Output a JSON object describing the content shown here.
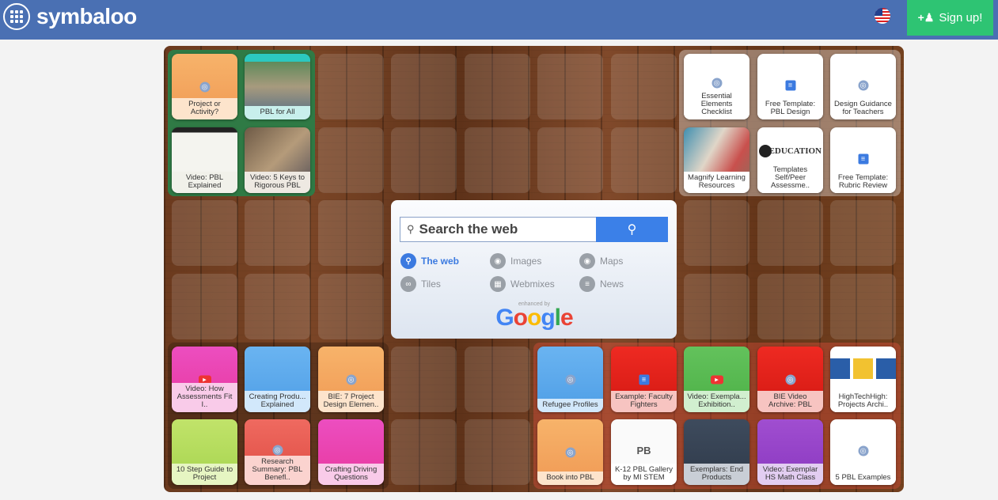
{
  "header": {
    "brand": "symbaloo",
    "signup_label": "Sign up!"
  },
  "colors": {
    "header_bg": "#4a70b3",
    "signup_bg": "#2ec473",
    "search_accent": "#3b80e8"
  },
  "search": {
    "placeholder": "Search the web",
    "options": [
      {
        "label": "The web",
        "icon": "search-icon"
      },
      {
        "label": "Images",
        "icon": "camera-icon"
      },
      {
        "label": "Maps",
        "icon": "map-pin-icon"
      },
      {
        "label": "Tiles",
        "icon": "link-icon"
      },
      {
        "label": "Webmixes",
        "icon": "grid-icon"
      },
      {
        "label": "News",
        "icon": "menu-icon"
      }
    ],
    "enhanced_by": "enhanced by",
    "provider": "Google"
  },
  "tiles": {
    "project_or_activity": "Project or Activity?",
    "pbl_for_all": "PBL for All",
    "video_pbl_explained": "Video: PBL Explained",
    "video_5_keys": "Video: 5 Keys to Rigorous PBL",
    "essential_elements": "Essential Elements Checklist",
    "free_template_pbl": "Free Template: PBL Design",
    "design_guidance": "Design Guidance for Teachers",
    "magnify_learning": "Magnify Learning Resources",
    "education_logo": "EDUCATION",
    "templates_self_peer": "Templates Self/Peer Assessme..",
    "free_template_rubric": "Free Template: Rubric Review",
    "video_how_assessments": "Video: How Assessments Fit I..",
    "creating_products": "Creating Produ... Explained",
    "bie_7_project": "BIE: 7 Project Design Elemen..",
    "refugee_profiles": "Refugee Profiles",
    "example_faculty": "Example: Faculty Fighters",
    "video_exemplar_exhibition": "Video: Exempla... Exhibition..",
    "bie_video_archive": "BIE Video Archive: PBL",
    "hightechhigh": "HighTechHigh: Projects Archi..",
    "ten_step_guide": "10 Step Guide to Project",
    "research_summary": "Research Summary: PBL Benefl..",
    "crafting_driving": "Crafting Driving Questions",
    "book_into_pbl": "Book into PBL",
    "k12_pbl_gallery": "K-12 PBL Gallery by MI STEM",
    "k12_badge": "PB",
    "exemplars_end": "Exemplars: End Products",
    "video_exemplar_hs": "Video: Exemplar HS Math Class",
    "five_pbl_examples": "5 PBL Examples"
  }
}
